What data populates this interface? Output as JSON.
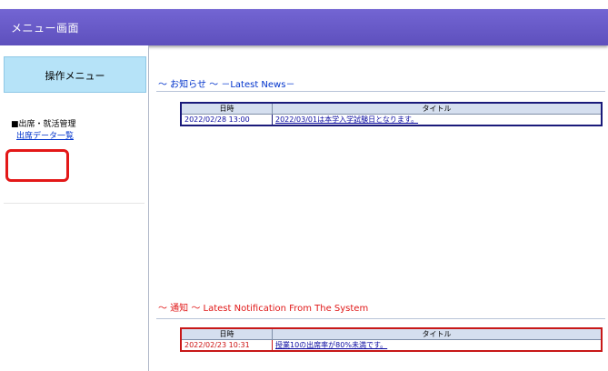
{
  "header": {
    "title": "メニュー画面"
  },
  "sidebar": {
    "menu_title": "操作メニュー",
    "section_label": "■出席・就活管理",
    "link_label": "出席データ一覧"
  },
  "news": {
    "heading": "～ お知らせ ～  －Latest News－",
    "columns": [
      "日時",
      "タイトル"
    ],
    "rows": [
      {
        "date": "2022/02/28 13:00",
        "title": "2022/03/01は本学入学試験日となります。"
      }
    ]
  },
  "notice": {
    "heading": "～ 通知 ～   Latest Notification From The System",
    "columns": [
      "日時",
      "タイトル"
    ],
    "rows": [
      {
        "date": "2022/02/23 10:31",
        "title": "授業10の出席率が80%未満です。"
      }
    ]
  },
  "colors": {
    "header_bg": "#6a5cc8",
    "menu_title_bg": "#b6e3f8",
    "highlight": "#e31818",
    "link": "#0033cc",
    "notice_red": "#e01818"
  }
}
